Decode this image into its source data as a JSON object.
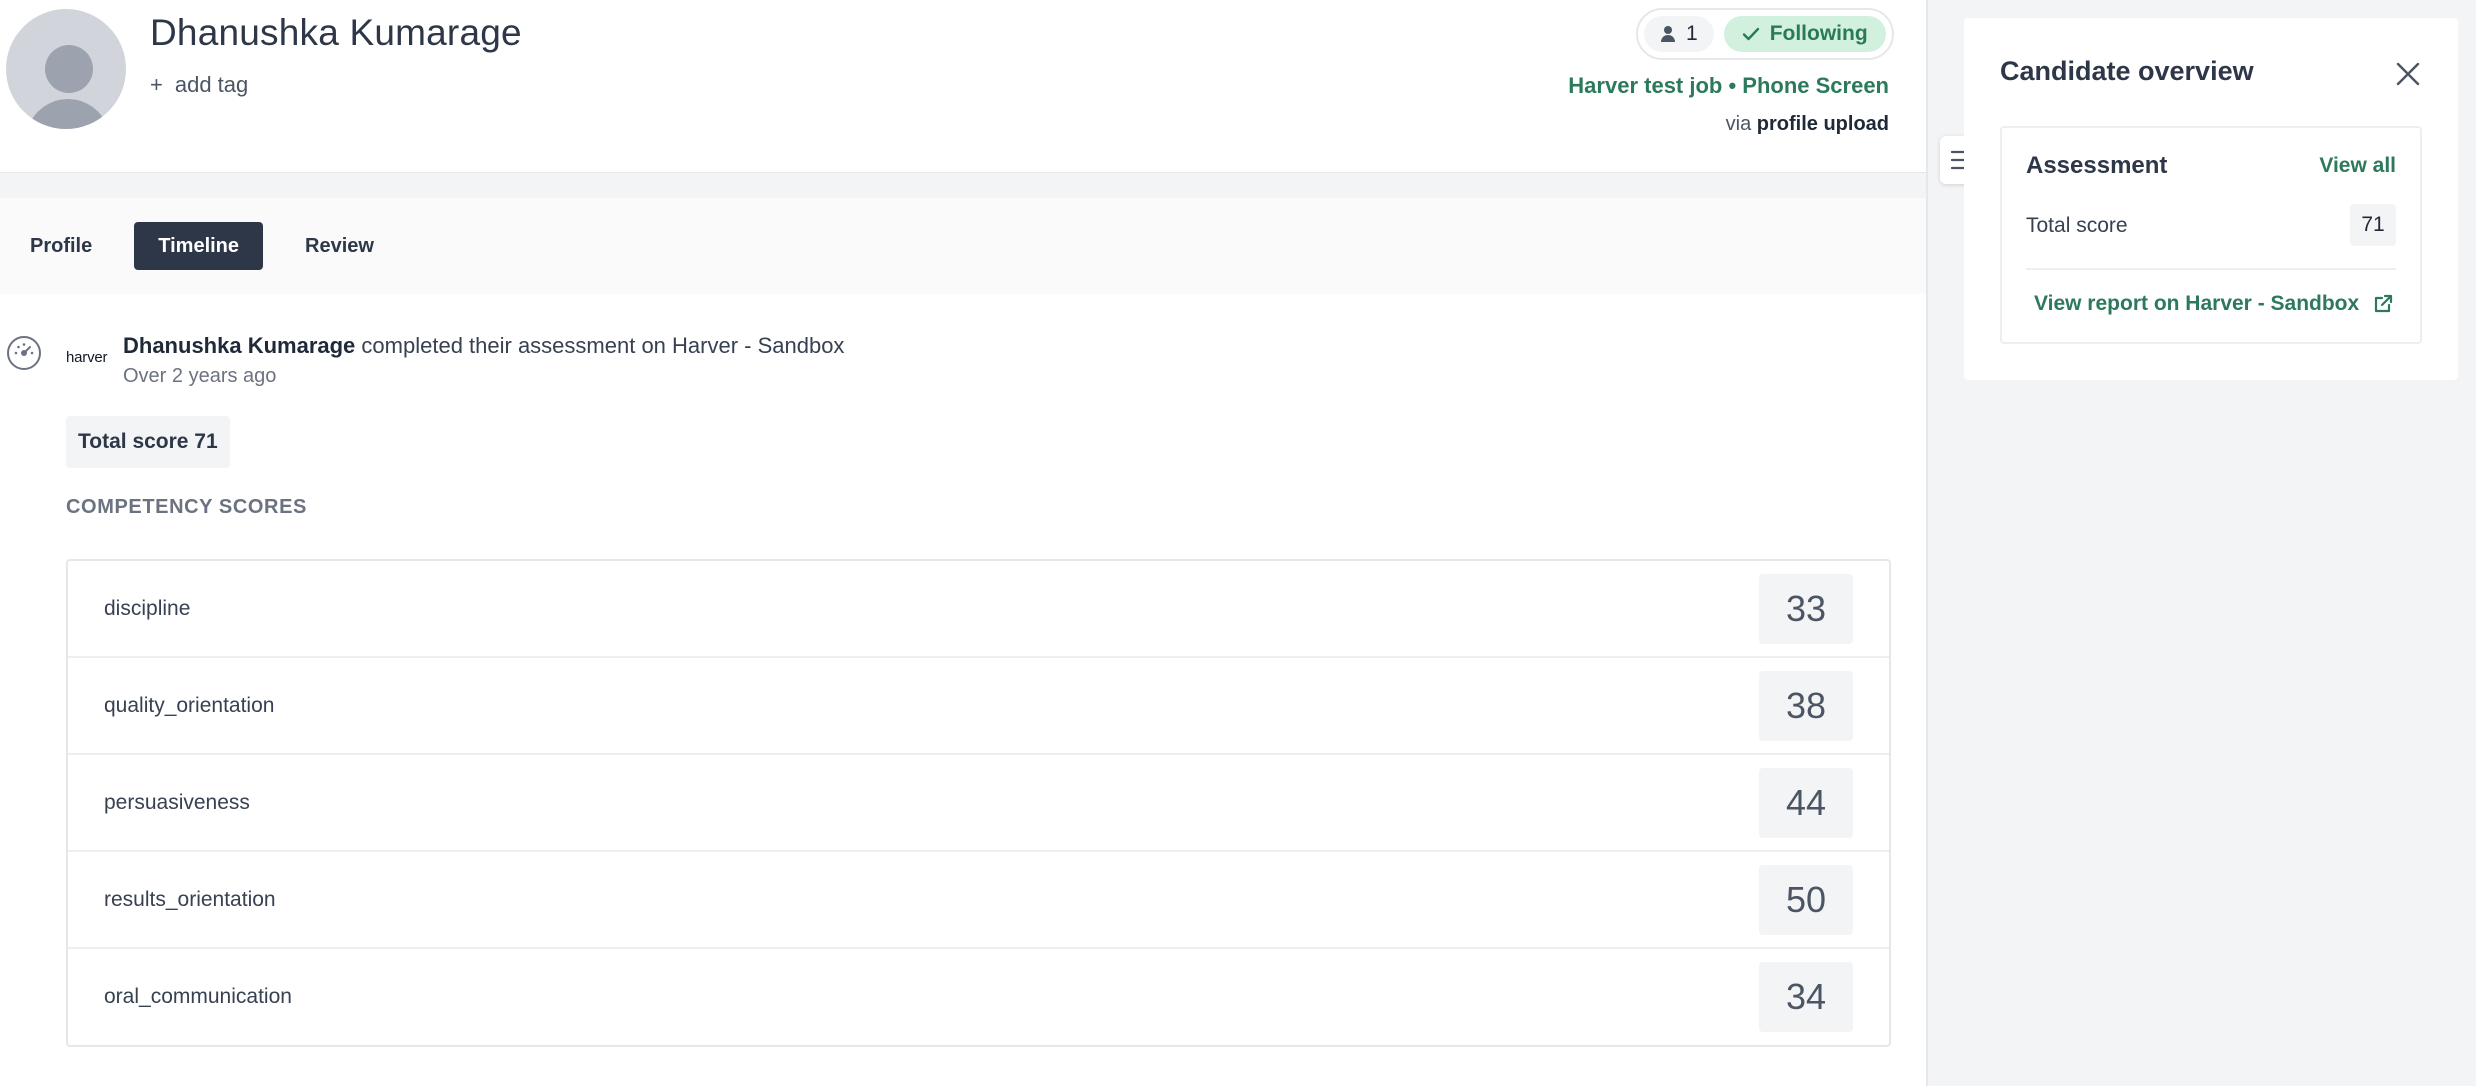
{
  "candidate": {
    "name": "Dhanushka Kumarage",
    "add_tag_label": "add tag",
    "follower_count": "1",
    "following_label": "Following",
    "job_label": "Harver test job • Phone Screen",
    "via_prefix": "via",
    "via_source": "profile upload"
  },
  "tabs": [
    {
      "label": "Profile",
      "active": false
    },
    {
      "label": "Timeline",
      "active": true
    },
    {
      "label": "Review",
      "active": false
    }
  ],
  "event": {
    "logo_text": "harver",
    "actor": "Dhanushka Kumarage",
    "action": "completed their assessment on Harver - Sandbox",
    "time": "Over 2 years ago",
    "total_score_label": "Total score 71"
  },
  "competency": {
    "heading": "COMPETENCY SCORES",
    "rows": [
      {
        "name": "discipline",
        "score": "33"
      },
      {
        "name": "quality_orientation",
        "score": "38"
      },
      {
        "name": "persuasiveness",
        "score": "44"
      },
      {
        "name": "results_orientation",
        "score": "50"
      },
      {
        "name": "oral_communication",
        "score": "34"
      }
    ]
  },
  "overview": {
    "title": "Candidate overview",
    "assessment_title": "Assessment",
    "view_all_label": "View all",
    "total_score_label": "Total score",
    "total_score_value": "71",
    "view_report_label": "View report on Harver - Sandbox"
  },
  "colors": {
    "brand_green": "#2c7a5b",
    "following_bg": "#d1f0de",
    "active_tab_bg": "#2d3748"
  }
}
